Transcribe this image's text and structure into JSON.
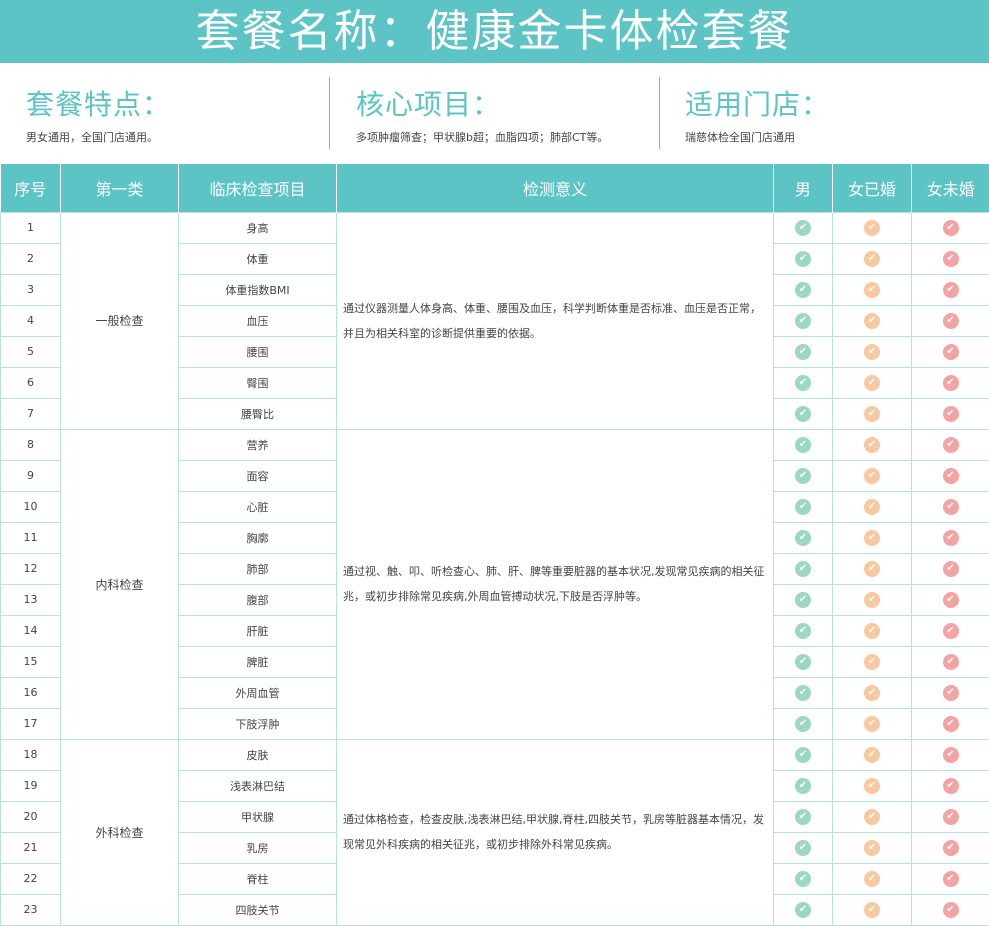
{
  "title": "套餐名称：健康金卡体检套餐",
  "info": [
    {
      "title": "套餐特点：",
      "desc": "男女通用，全国门店通用。"
    },
    {
      "title": "核心项目：",
      "desc": "多项肿瘤筛查；甲状腺b超；血脂四项；肺部CT等。"
    },
    {
      "title": "适用门店：",
      "desc": "瑞慈体检全国门店通用"
    }
  ],
  "table": {
    "headers": [
      "序号",
      "第一类",
      "临床检查项目",
      "检测意义",
      "男",
      "女已婚",
      "女未婚"
    ],
    "groups": [
      {
        "category": "一般检查",
        "meaning": "通过仪器测量人体身高、体重、腰围及血压，科学判断体重是否标准、血压是否正常，并且为相关科室的诊断提供重要的依据。",
        "rows": [
          {
            "no": "1",
            "item": "身高",
            "male": true,
            "female_married": true,
            "female_unmarried": true
          },
          {
            "no": "2",
            "item": "体重",
            "male": true,
            "female_married": true,
            "female_unmarried": true
          },
          {
            "no": "3",
            "item": "体重指数BMI",
            "male": true,
            "female_married": true,
            "female_unmarried": true
          },
          {
            "no": "4",
            "item": "血压",
            "male": true,
            "female_married": true,
            "female_unmarried": true
          },
          {
            "no": "5",
            "item": "腰围",
            "male": true,
            "female_married": true,
            "female_unmarried": true
          },
          {
            "no": "6",
            "item": "臀围",
            "male": true,
            "female_married": true,
            "female_unmarried": true
          },
          {
            "no": "7",
            "item": "腰臀比",
            "male": true,
            "female_married": true,
            "female_unmarried": true
          }
        ]
      },
      {
        "category": "内科检查",
        "meaning": "通过视、触、叩、听检查心、肺、肝、脾等重要脏器的基本状况,发现常见疾病的相关征兆，或初步排除常见疾病,外周血管搏动状况,下肢是否浮肿等。",
        "rows": [
          {
            "no": "8",
            "item": "营养",
            "male": true,
            "female_married": true,
            "female_unmarried": true
          },
          {
            "no": "9",
            "item": "面容",
            "male": true,
            "female_married": true,
            "female_unmarried": true
          },
          {
            "no": "10",
            "item": "心脏",
            "male": true,
            "female_married": true,
            "female_unmarried": true
          },
          {
            "no": "11",
            "item": "胸廓",
            "male": true,
            "female_married": true,
            "female_unmarried": true
          },
          {
            "no": "12",
            "item": "肺部",
            "male": true,
            "female_married": true,
            "female_unmarried": true
          },
          {
            "no": "13",
            "item": "腹部",
            "male": true,
            "female_married": true,
            "female_unmarried": true
          },
          {
            "no": "14",
            "item": "肝脏",
            "male": true,
            "female_married": true,
            "female_unmarried": true
          },
          {
            "no": "15",
            "item": "脾脏",
            "male": true,
            "female_married": true,
            "female_unmarried": true
          },
          {
            "no": "16",
            "item": "外周血管",
            "male": true,
            "female_married": true,
            "female_unmarried": true
          },
          {
            "no": "17",
            "item": "下肢浮肿",
            "male": true,
            "female_married": true,
            "female_unmarried": true
          }
        ]
      },
      {
        "category": "外科检查",
        "meaning": "通过体格检查，检查皮肤,浅表淋巴结,甲状腺,脊柱,四肢关节，乳房等脏器基本情况，发现常见外科疾病的相关征兆，或初步排除外科常见疾病。",
        "rows": [
          {
            "no": "18",
            "item": "皮肤",
            "male": true,
            "female_married": true,
            "female_unmarried": true
          },
          {
            "no": "19",
            "item": "浅表淋巴结",
            "male": true,
            "female_married": true,
            "female_unmarried": true
          },
          {
            "no": "20",
            "item": "甲状腺",
            "male": true,
            "female_married": true,
            "female_unmarried": true
          },
          {
            "no": "21",
            "item": "乳房",
            "male": true,
            "female_married": true,
            "female_unmarried": true
          },
          {
            "no": "22",
            "item": "脊柱",
            "male": true,
            "female_married": true,
            "female_unmarried": true
          },
          {
            "no": "23",
            "item": "四肢关节",
            "male": true,
            "female_married": true,
            "female_unmarried": true
          }
        ]
      }
    ]
  },
  "colors": {
    "accent": "#5cc4c4",
    "check_male": "#9ad8c0",
    "check_female_married": "#f8c8a0",
    "check_female_unmarried": "#f4a2a2"
  },
  "icons": {
    "male": "check-circle-green-icon",
    "female_married": "check-circle-orange-icon",
    "female_unmarried": "check-circle-red-icon"
  }
}
